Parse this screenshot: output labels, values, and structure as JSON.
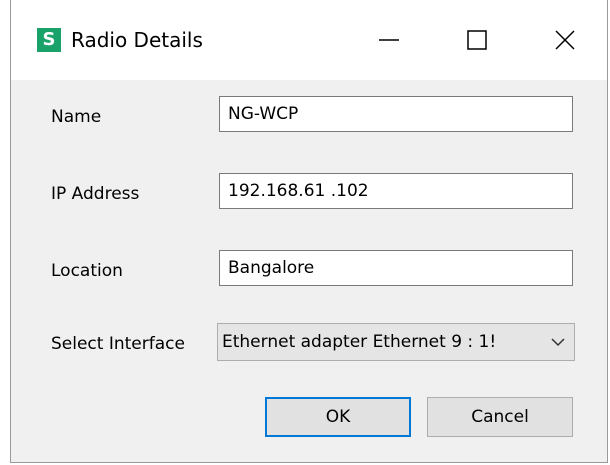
{
  "window": {
    "title": "Radio Details",
    "app_icon_letter": "S",
    "app_icon_color": "#1aa26b"
  },
  "form": {
    "name_label": "Name",
    "name_value": "NG-WCP",
    "ip_label": "IP Address",
    "ip_value": "192.168.61 .102",
    "location_label": "Location",
    "location_value": "Bangalore",
    "interface_label": "Select Interface",
    "interface_selected": "Ethernet adapter Ethernet 9 : 1!"
  },
  "buttons": {
    "ok_label": "OK",
    "cancel_label": "Cancel"
  },
  "icons": {
    "minimize": "minimize-icon",
    "maximize": "maximize-icon",
    "close": "close-icon",
    "dropdown": "chevron-down-icon"
  },
  "colors": {
    "accent": "#0078d7"
  }
}
